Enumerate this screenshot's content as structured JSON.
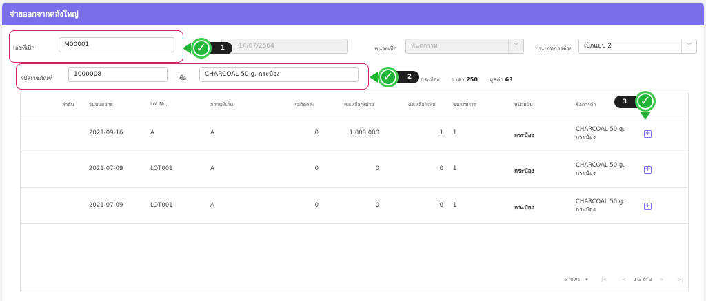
{
  "header": {
    "title": "จ่ายออกจากคลังใหญ่"
  },
  "form": {
    "doc_no_label": "เลขที่เบิก",
    "doc_no_value": "M00001",
    "date_value": "14/07/2564",
    "unit_label": "หน่วยเบิก",
    "unit_value": "ทันตกรรม",
    "pay_type_label": "ประเภทการจ่าย",
    "pay_type_value": "เบิกแบบ 2",
    "product_code_label": "รหัสเวชภัณฑ์",
    "product_code_value": "1000008",
    "name_label": "ชื่อ",
    "name_value": "CHARCOAL 50 g. กระป๋อง"
  },
  "info": {
    "unit_text": "กระป๋อง",
    "price_label": "ราคา",
    "price_value": "250",
    "amount_label": "มูลค่า",
    "amount_value": "63"
  },
  "callouts": {
    "one": "1",
    "two": "2",
    "three": "3",
    "check": "✓"
  },
  "table": {
    "columns": [
      "ลำดับ",
      "วันหมดอายุ",
      "Lot No.",
      "สถานที่เก็บ",
      "รอตัดคลัง",
      "คงเหลือ/หน่วย",
      "คงเหลือ/แพค",
      "ขนาดบรรจุ",
      "หน่วยนับ",
      "ชื่อการค้า"
    ],
    "rows": [
      {
        "exp": "2021-09-16",
        "lot": "A",
        "loc": "A",
        "pending": "0",
        "bal_unit": "1,000,000",
        "bal_pack": "1",
        "pack_size": "1",
        "unit": "กระป๋อง",
        "trade_name": "CHARCOAL 50 g. กระป๋อง"
      },
      {
        "exp": "2021-07-09",
        "lot": "LOT001",
        "loc": "A",
        "pending": "0",
        "bal_unit": "0",
        "bal_pack": "0",
        "pack_size": "1",
        "unit": "กระป๋อง",
        "trade_name": "CHARCOAL 50 g. กระป๋อง"
      },
      {
        "exp": "2021-07-09",
        "lot": "LOT001",
        "loc": "A",
        "pending": "0",
        "bal_unit": "0",
        "bal_pack": "0",
        "pack_size": "1",
        "unit": "กระป๋อง",
        "trade_name": "CHARCOAL 50 g. กระป๋อง"
      }
    ],
    "add_symbol": "+"
  },
  "pagination": {
    "rows_per_page": "5 rows",
    "dropdown_icon": "▾",
    "first": "|<",
    "prev": "<",
    "range": "1-3 of 3",
    "next": ">",
    "last": ">|"
  },
  "colors": {
    "accent": "#7a6fe9",
    "highlight": "#d0216b",
    "callout_green": "#21b537"
  }
}
